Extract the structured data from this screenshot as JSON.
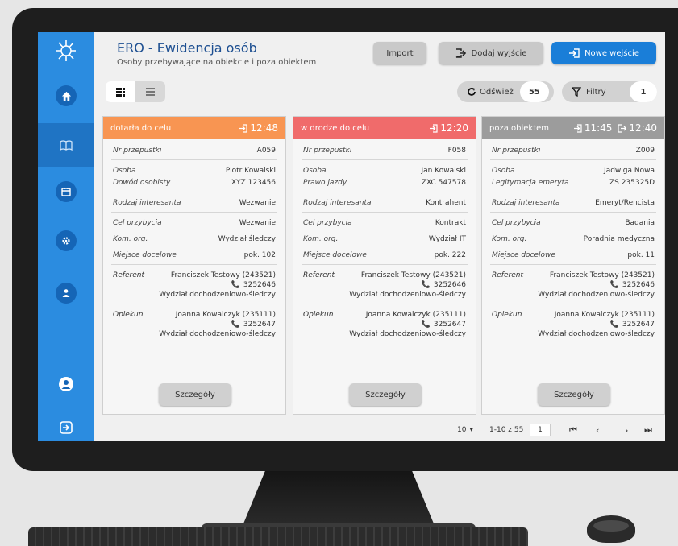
{
  "app": {
    "title": "ERO - Ewidencja osób",
    "subtitle": "Osoby przebywające na obiekcie i poza obiektem"
  },
  "toolbar": {
    "import_label": "Import",
    "exit_label": "Dodaj wyjście",
    "new_entry_label": "Nowe wejście",
    "refresh_label": "Odśwież",
    "refresh_count": "55",
    "filters_label": "Filtry",
    "filters_count": "1"
  },
  "colors": {
    "card1_header": "#f89552",
    "card2_header": "#f06b6b",
    "card3_header": "#9c9c9c",
    "sidebar": "#2b8ce0",
    "primary_button": "#1a7ed8"
  },
  "cards": [
    {
      "status": "dotarła do celu",
      "time_in": "12:48",
      "time_out": "",
      "pass_label": "Nr przepustki",
      "pass": "A059",
      "person_label": "Osoba",
      "person": "Piotr Kowalski",
      "doc_label": "Dowód osobisty",
      "doc": "XYZ 123456",
      "type_label": "Rodzaj interesanta",
      "type": "Wezwanie",
      "purpose_label": "Cel przybycia",
      "purpose": "Wezwanie",
      "org_label": "Kom. org.",
      "org": "Wydział śledczy",
      "place_label": "Miejsce docelowe",
      "place": "pok. 102",
      "referent_label": "Referent",
      "referent": "Franciszek Testowy (243521)",
      "referent_phone": "3252646",
      "referent_unit": "Wydział dochodzeniowo-śledczy",
      "guardian_label": "Opiekun",
      "guardian": "Joanna Kowalczyk (235111)",
      "guardian_phone": "3252647",
      "guardian_unit": "Wydział dochodzeniowo-śledczy",
      "details_label": "Szczegóły"
    },
    {
      "status": "w drodze do celu",
      "time_in": "12:20",
      "time_out": "",
      "pass_label": "Nr przepustki",
      "pass": "F058",
      "person_label": "Osoba",
      "person": "Jan Kowalski",
      "doc_label": "Prawo jazdy",
      "doc": "ZXC 547578",
      "type_label": "Rodzaj interesanta",
      "type": "Kontrahent",
      "purpose_label": "Cel przybycia",
      "purpose": "Kontrakt",
      "org_label": "Kom. org.",
      "org": "Wydział IT",
      "place_label": "Miejsce docelowe",
      "place": "pok. 222",
      "referent_label": "Referent",
      "referent": "Franciszek Testowy (243521)",
      "referent_phone": "3252646",
      "referent_unit": "Wydział dochodzeniowo-śledczy",
      "guardian_label": "Opiekun",
      "guardian": "Joanna Kowalczyk (235111)",
      "guardian_phone": "3252647",
      "guardian_unit": "Wydział dochodzeniowo-śledczy",
      "details_label": "Szczegóły"
    },
    {
      "status": "poza obiektem",
      "time_in": "11:45",
      "time_out": "12:40",
      "pass_label": "Nr przepustki",
      "pass": "Z009",
      "person_label": "Osoba",
      "person": "Jadwiga Nowa",
      "doc_label": "Legitymacja emeryta",
      "doc": "ZS 235325D",
      "type_label": "Rodzaj interesanta",
      "type": "Emeryt/Rencista",
      "purpose_label": "Cel przybycia",
      "purpose": "Badania",
      "org_label": "Kom. org.",
      "org": "Poradnia medyczna",
      "place_label": "Miejsce docelowe",
      "place": "pok. 11",
      "referent_label": "Referent",
      "referent": "Franciszek Testowy (243521)",
      "referent_phone": "3252646",
      "referent_unit": "Wydział dochodzeniowo-śledczy",
      "guardian_label": "Opiekun",
      "guardian": "Joanna Kowalczyk (235111)",
      "guardian_phone": "3252647",
      "guardian_unit": "Wydział dochodzeniowo-śledczy",
      "details_label": "Szczegóły"
    }
  ],
  "pagination": {
    "page_size": "10",
    "range": "1-10 z 55",
    "current_page": "1"
  },
  "sidebar": {
    "items": [
      "home-icon",
      "book-icon",
      "calendar-icon",
      "gear-icon",
      "user-badge-icon",
      "account-icon",
      "logout-icon"
    ]
  }
}
